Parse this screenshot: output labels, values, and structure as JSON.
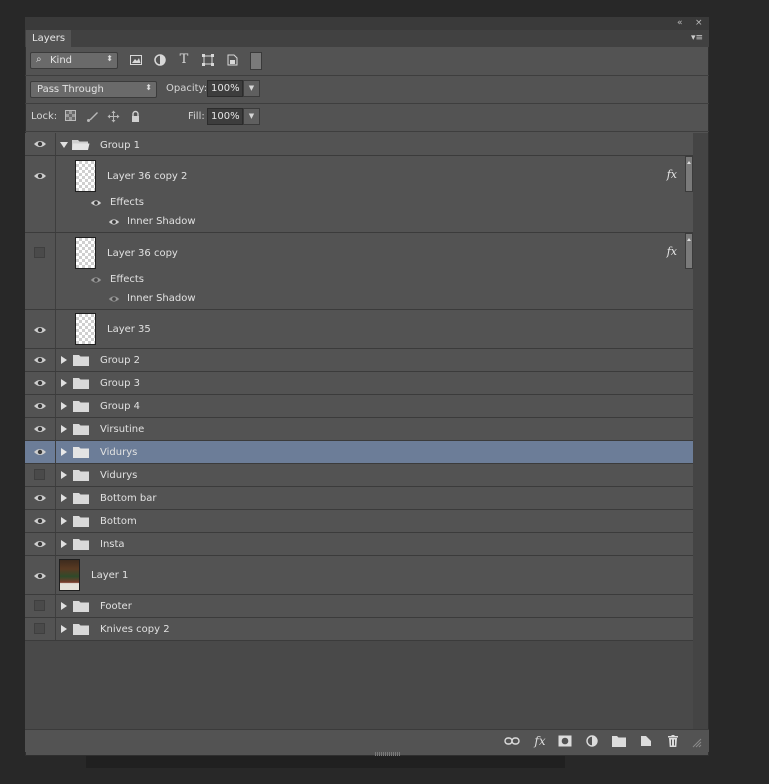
{
  "panel": {
    "tab_label": "Layers",
    "collapse_glyph": "«",
    "close_glyph": "×",
    "menu_glyph": "▾≡"
  },
  "filter": {
    "kind_label": "Kind",
    "icons": [
      "image-filter-icon",
      "adjustment-filter-icon",
      "type-filter-icon",
      "shape-filter-icon",
      "smart-object-filter-icon",
      "filter-toggle-icon"
    ]
  },
  "blending": {
    "mode": "Pass Through",
    "opacity_label": "Opacity:",
    "opacity_value": "100%",
    "lock_label": "Lock:",
    "fill_label": "Fill:",
    "fill_value": "100%"
  },
  "layers": [
    {
      "name": "Group 1",
      "type": "group",
      "visible": true,
      "expanded": true
    },
    {
      "name": "Layer 36 copy 2",
      "type": "layer",
      "visible": true,
      "fx": "fx",
      "effects_label": "Effects",
      "effect": "Inner Shadow"
    },
    {
      "name": "Layer 36 copy",
      "type": "layer",
      "visible": false,
      "fx": "fx",
      "effects_label": "Effects",
      "effect": "Inner Shadow"
    },
    {
      "name": "Layer 35",
      "type": "layer",
      "visible": true
    },
    {
      "name": "Group 2",
      "type": "group",
      "visible": true
    },
    {
      "name": "Group 3",
      "type": "group",
      "visible": true
    },
    {
      "name": "Group 4",
      "type": "group",
      "visible": true
    },
    {
      "name": "Virsutine",
      "type": "group",
      "visible": true
    },
    {
      "name": "Vidurys",
      "type": "group",
      "visible": true,
      "selected": true
    },
    {
      "name": "Vidurys",
      "type": "group",
      "visible": false
    },
    {
      "name": "Bottom bar",
      "type": "group",
      "visible": true
    },
    {
      "name": "Bottom",
      "type": "group",
      "visible": true
    },
    {
      "name": "Insta",
      "type": "group",
      "visible": true
    },
    {
      "name": "Layer 1",
      "type": "image-layer",
      "visible": true
    },
    {
      "name": "Footer",
      "type": "group",
      "visible": false
    },
    {
      "name": "Knives copy 2",
      "type": "group",
      "visible": false
    }
  ],
  "footer_icons": [
    "link-layers-icon",
    "fx-icon",
    "mask-icon",
    "adjustment-layer-icon",
    "new-group-icon",
    "new-layer-icon",
    "trash-icon"
  ],
  "footer_fx_label": "fx",
  "colors": {
    "panel_bg": "#535353",
    "selected_row": "#6c7d98",
    "app_bg": "#282828"
  }
}
